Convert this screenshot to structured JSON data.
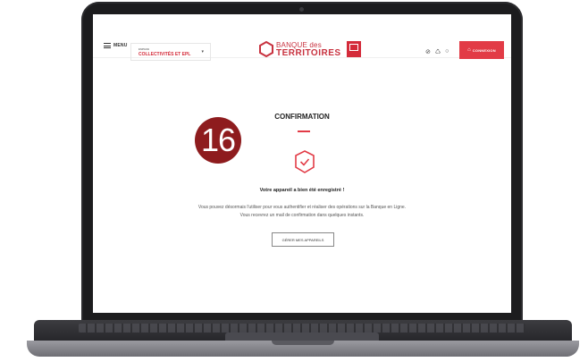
{
  "header": {
    "menu_label": "MENU",
    "espace_label": "ESPACE",
    "espace_value": "COLLECTIVITÉS ET EPL",
    "logo_line1": "BANQUE des",
    "logo_line2": "TERRITOIRES",
    "icons": [
      "accessibility-icon",
      "recycle-icon",
      "search-icon"
    ],
    "connect_label": "CONNEXION"
  },
  "main": {
    "step_number": "16",
    "title": "CONFIRMATION",
    "message_bold": "Votre appareil a bien été enregistré !",
    "message_line1": "Vous pouvez désormais l'utiliser pour vous authentifier et réaliser des opérations sur la Banque en Ligne.",
    "message_line2": "Vous recevrez un mail de confirmation dans quelques instants.",
    "button_label": "GÉRER MES APPAREILS"
  },
  "colors": {
    "accent": "#e23b46",
    "brand": "#c8323f",
    "step_badge": "#8e1c1e"
  }
}
